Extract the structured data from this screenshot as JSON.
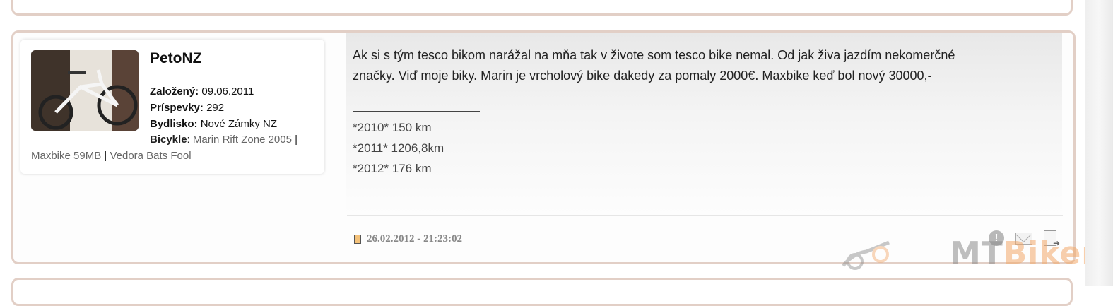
{
  "post": {
    "author": {
      "username": "PetoNZ",
      "founded_label": "Založený:",
      "founded_value": "09.06.2011",
      "posts_label": "Príspevky:",
      "posts_value": "292",
      "location_label": "Bydlisko:",
      "location_value": "Nové Zámky NZ",
      "bikes_label": "Bicykle",
      "bikes": [
        "Marin Rift Zone 2005",
        "Maxbike 59MB",
        "Vedora Bats Fool"
      ]
    },
    "message_line1": "Ak si s tým tesco bikom narážal na mňa tak v živote som tesco bike nemal. Od jak živa jazdím nekomerčné",
    "message_line2": "značky. Viď moje biky. Marin je vrcholový bike dakedy za pomaly 2000€. Maxbike keď bol nový 30000,-",
    "signature": [
      "*2010* 150 km",
      "*2011* 1206,8km",
      "*2012* 176 km"
    ],
    "date": "26.02.2012 - 21:23:02",
    "icons": {
      "report": "warning-icon",
      "message": "mail-icon",
      "quote": "quote-icon"
    }
  },
  "watermark": {
    "part1": "MT",
    "part2": "Biker"
  }
}
